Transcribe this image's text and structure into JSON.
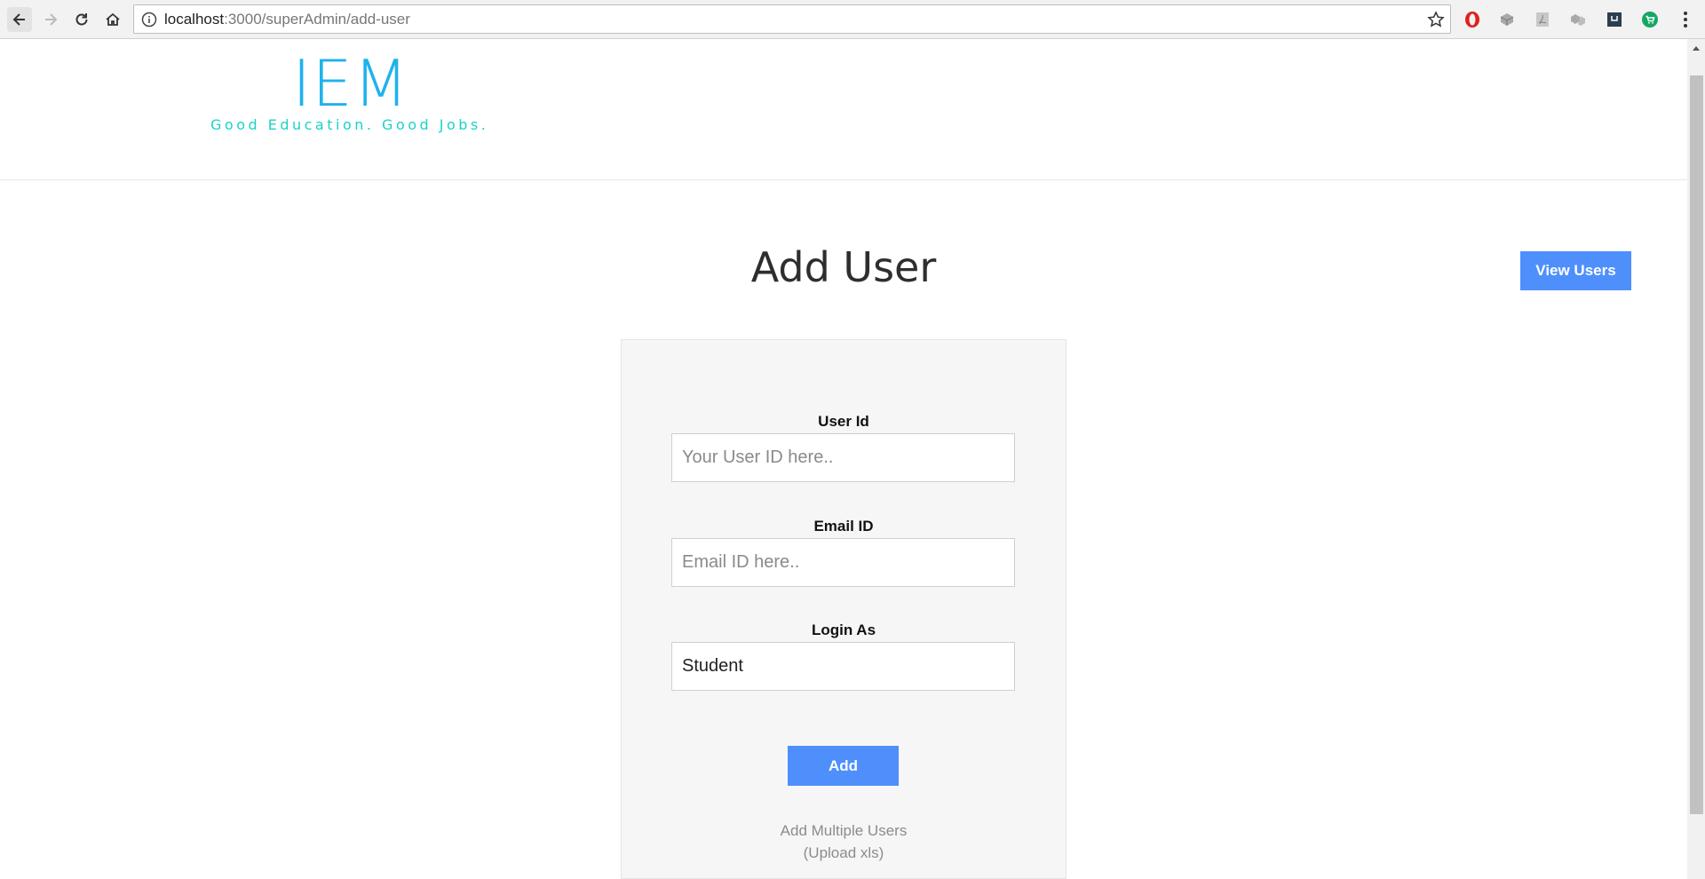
{
  "browser": {
    "url_host": "localhost",
    "url_path": ":3000/superAdmin/add-user"
  },
  "header": {
    "logo": "IEM",
    "tagline": "Good Education. Good Jobs."
  },
  "main": {
    "title": "Add User",
    "view_users_label": "View Users"
  },
  "form": {
    "user_id": {
      "label": "User Id",
      "placeholder": "Your User ID here..",
      "value": ""
    },
    "email": {
      "label": "Email ID",
      "placeholder": "Email ID here..",
      "value": ""
    },
    "login_as": {
      "label": "Login As",
      "value": "Student",
      "options": [
        "Student"
      ]
    },
    "add_label": "Add",
    "multi_line1": "Add Multiple Users",
    "multi_line2": "(Upload xls)"
  },
  "colors": {
    "logo": "#1fb2ec",
    "tagline": "#19d3c7",
    "primary_button": "#4e8ffc"
  }
}
